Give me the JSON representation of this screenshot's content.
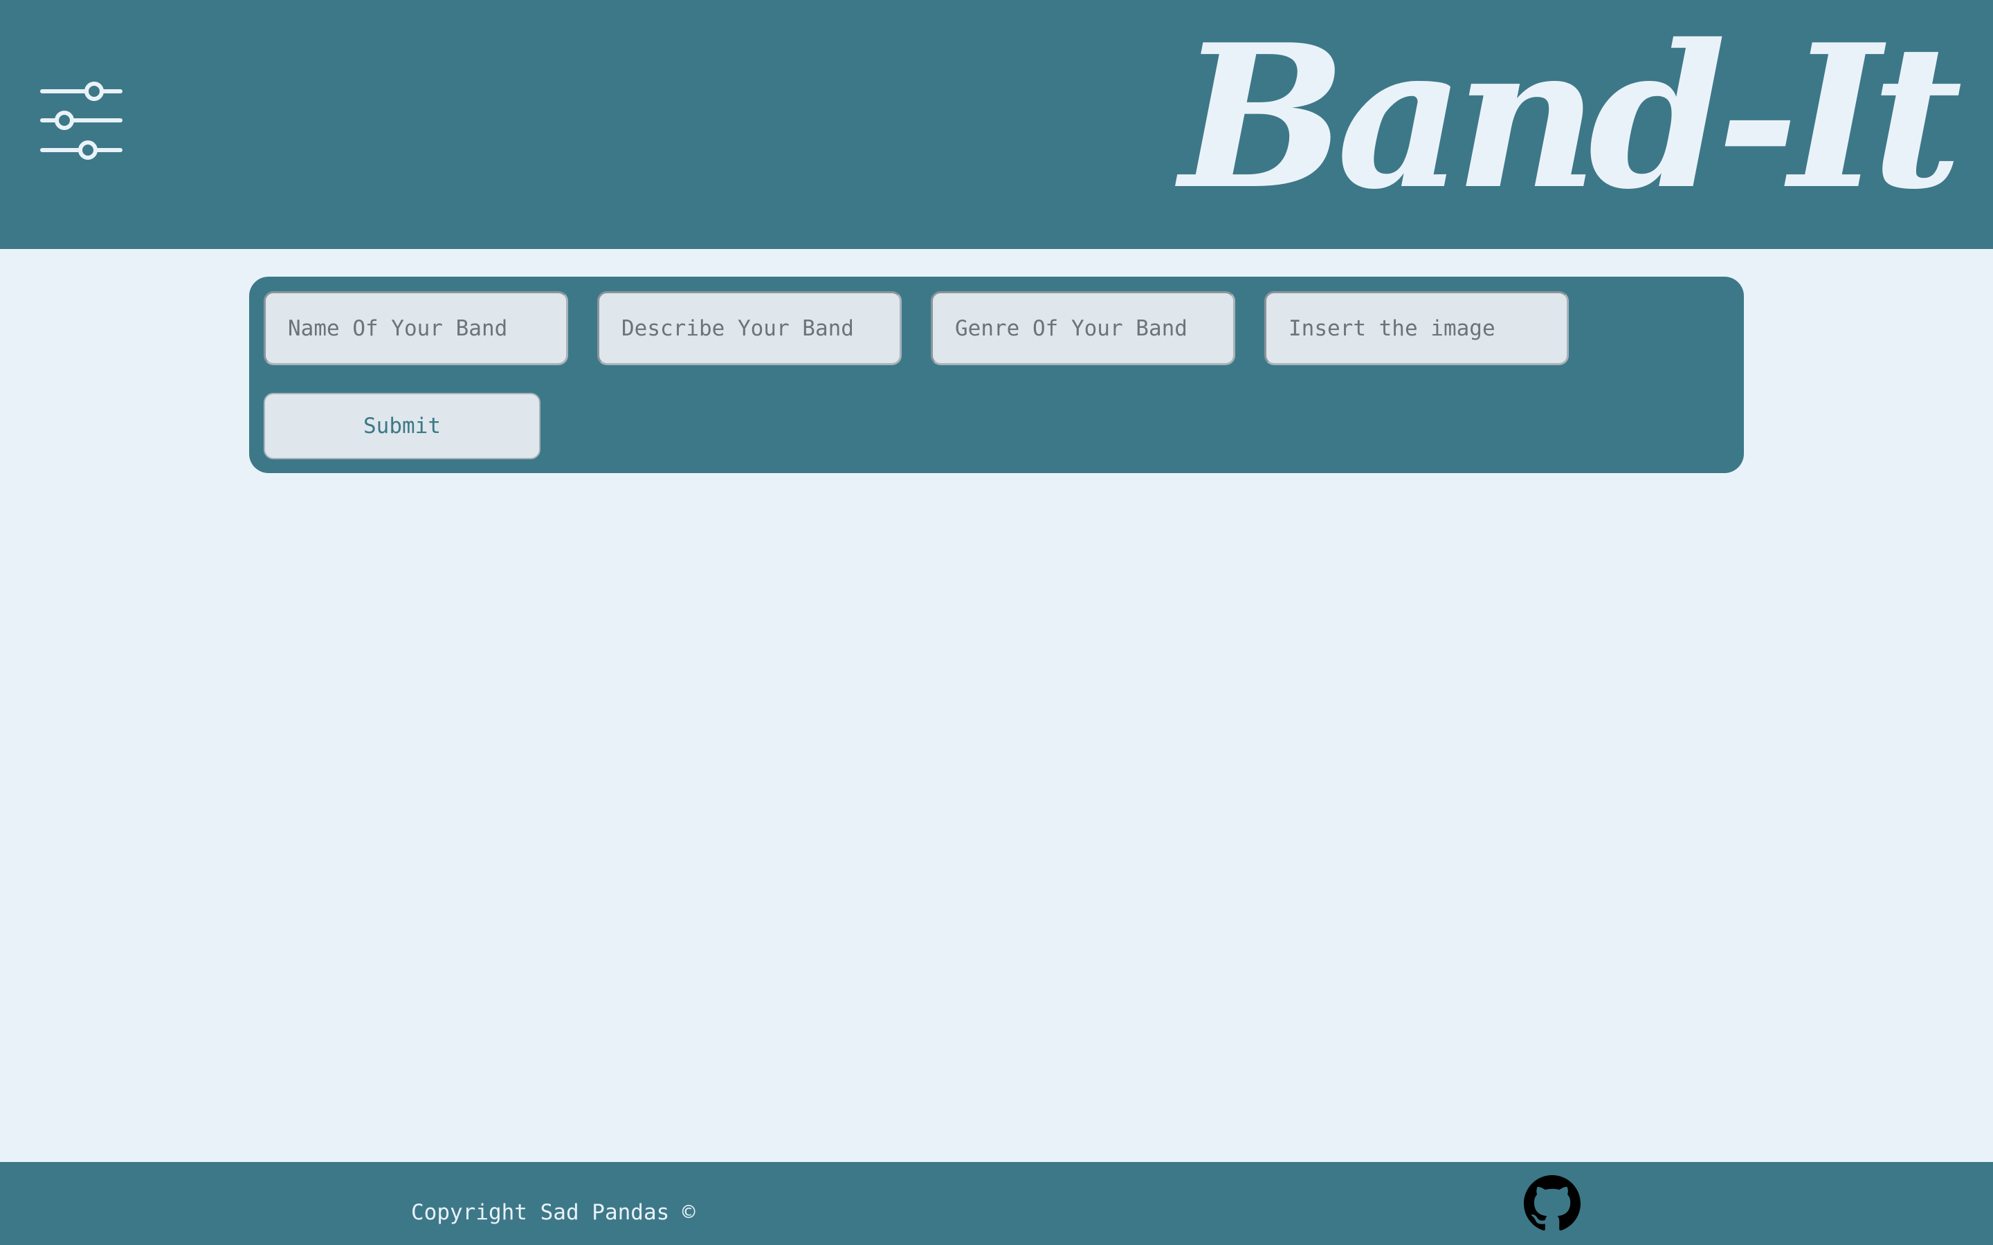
{
  "header": {
    "brand": "Band-It",
    "filter_icon": "sliders-icon"
  },
  "form": {
    "band_name": {
      "value": "",
      "placeholder": "Name Of Your Band"
    },
    "band_description": {
      "value": "",
      "placeholder": "Describe Your Band"
    },
    "band_genre": {
      "value": "",
      "placeholder": "Genre Of Your Band"
    },
    "band_image": {
      "value": "",
      "placeholder": "Insert the image"
    },
    "submit_label": "Submit"
  },
  "footer": {
    "copyright": "Copyright Sad Pandas ©",
    "github_icon": "github-icon"
  },
  "colors": {
    "primary": "#3d7888",
    "background": "#eaf2f9",
    "field": "#dfe7ec"
  }
}
